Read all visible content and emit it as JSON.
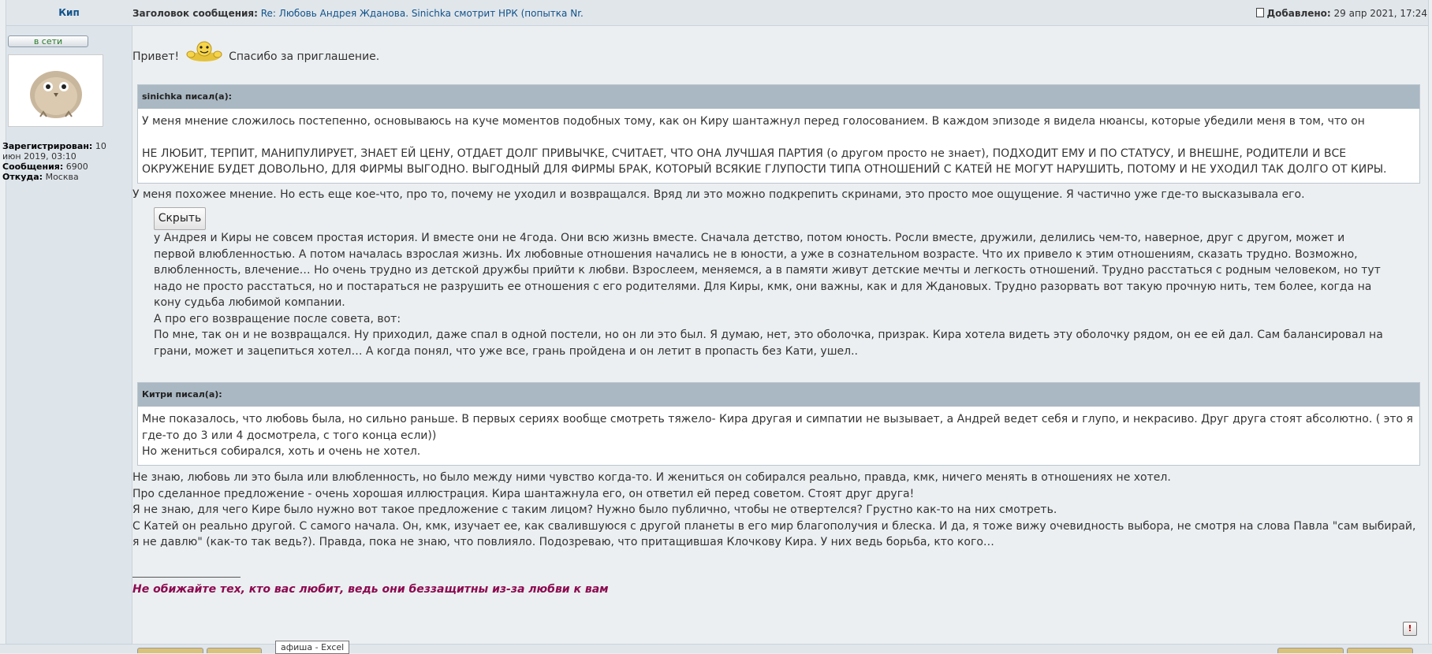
{
  "post": {
    "author": "Кип",
    "subject_label": "Заголовок сообщения:",
    "subject_link": "Re: Любовь Андрея Жданова. Sinichka смотрит НРК (попытка Nr.",
    "added_label": "Добавлено:",
    "added_date": "29 апр 2021, 17:24"
  },
  "profile": {
    "online_label": "в сети",
    "registered_label": "Зарегистрирован:",
    "registered_value": "10 июн 2019, 03:10",
    "messages_label": "Сообщения:",
    "messages_value": "6900",
    "from_label": "Откуда:",
    "from_value": "Москва"
  },
  "body": {
    "greeting_before": "Привет!",
    "greeting_after": "Спасибо за приглашение.",
    "quote1": {
      "author": "sinichka писал(а):",
      "p1": "У меня мнение сложилось постепенно, основываюсь на куче моментов подобных тому, как он Киру шантажнул перед голосованием. В каждом эпизоде я видела нюансы, которые убедили меня в том, что он",
      "p2": "НЕ ЛЮБИТ, ТЕРПИТ, МАНИПУЛИРУЕТ, ЗНАЕТ ЕЙ ЦЕНУ, ОТДАЕТ ДОЛГ ПРИВЫЧКЕ, СЧИТАЕТ, ЧТО ОНА ЛУЧШАЯ ПАРТИЯ (о другом просто не знает), ПОДХОДИТ ЕМУ И ПО СТАТУСУ, И ВНЕШНЕ, РОДИТЕЛИ И ВСЕ ОКРУЖЕНИЕ БУДЕТ ДОВОЛЬНО, ДЛЯ ФИРМЫ ВЫГОДНО. ВЫГОДНЫЙ ДЛЯ ФИРМЫ БРАК, КОТОРЫЙ ВСЯКИЕ ГЛУПОСТИ ТИПА ОТНОШЕНИЙ С КАТЕЙ НЕ МОГУТ НАРУШИТЬ, ПОТОМУ И НЕ УХОДИЛ ТАК ДОЛГО ОТ КИРЫ."
    },
    "reply1": "У меня похожее мнение. Но есть еще кое-что, про то, почему не уходил и возвращался. Вряд ли это можно подкрепить скринами, это просто мое ощущение. Я частично уже где-то высказывала его.",
    "spoiler_button": "Скрыть",
    "spoiler_p1": "у Андрея и Киры не совсем простая история. И вместе они не 4года. Они всю жизнь вместе. Сначала детство, потом юность. Росли вместе, дружили, делились чем-то, наверное, друг с другом, может и первой влюбленностью. А потом началась взрослая жизнь. Их любовные отношения начались не в юности, а уже в сознательном возрасте. Что их привело к этим отношениям, сказать трудно. Возможно, влюбленность, влечение… Но очень трудно из детской дружбы прийти к любви. Взрослеем, меняемся, а в памяти живут детские мечты и легкость отношений. Трудно расстаться с родным человеком, но тут надо не просто расстаться, но и постараться не разрушить ее отношения с его родителями. Для Киры, кмк, они важны, как и для Ждановых. Трудно разорвать вот такую прочную нить, тем более, когда на кону судьба любимой компании.",
    "spoiler_p2": "А про его возвращение после совета, вот:",
    "spoiler_p3": "По мне, так он и не возвращался. Ну приходил, даже спал в одной постели, но он ли это был. Я думаю, нет, это оболочка, призрак. Кира хотела видеть эту оболочку рядом, он ее ей дал. Сам балансировал на грани, может и зацепиться хотел… А когда понял, что уже все, грань пройдена и он летит в пропасть без Кати, ушел..",
    "quote2": {
      "author": "Китри писал(а):",
      "p1": "Мне показалось, что любовь была, но сильно раньше. В первых сериях вообще смотреть тяжело- Кира другая и симпатии не вызывает, а Андрей ведет себя и глупо, и некрасиво. Друг друга стоят абсолютно. ( это я где-то до 3 или 4 досмотрела, с того конца если))",
      "p2": "Но жениться собирался, хоть и очень не хотел."
    },
    "reply2_l1": "Не знаю, любовь ли это была или влюбленность, но было между ними чувство когда-то. И жениться он собирался реально, правда, кмк, ничего менять в отношениях не хотел.",
    "reply2_l2": "Про сделанное предложение - очень хорошая иллюстрация. Кира шантажнула его, он ответил ей перед советом. Стоят друг друга!",
    "reply2_l3": "Я не знаю, для чего Кире было нужно вот такое предложение с таким лицом? Нужно было публично, чтобы не отвертелся? Грустно как-то на них смотреть.",
    "reply2_l4": "С Катей он реально другой. С самого начала. Он, кмк, изучает ее, как свалившуюся с другой планеты в его мир благополучия и блеска. И да, я тоже вижу очевидность выбора, не смотря на слова Павла \"сам выбирай, я не давлю\" (как-то так ведь?). Правда, пока не знаю, что повлияло. Подозреваю, что притащившая Клочкову Кира. У них ведь борьба, кто кого…",
    "signature": "Не обижайте тех, кто вас любит, ведь они беззащитны из-за любви к вам"
  },
  "controls": {
    "report_icon": "!",
    "taskbar_tooltip": "афиша - Excel"
  }
}
